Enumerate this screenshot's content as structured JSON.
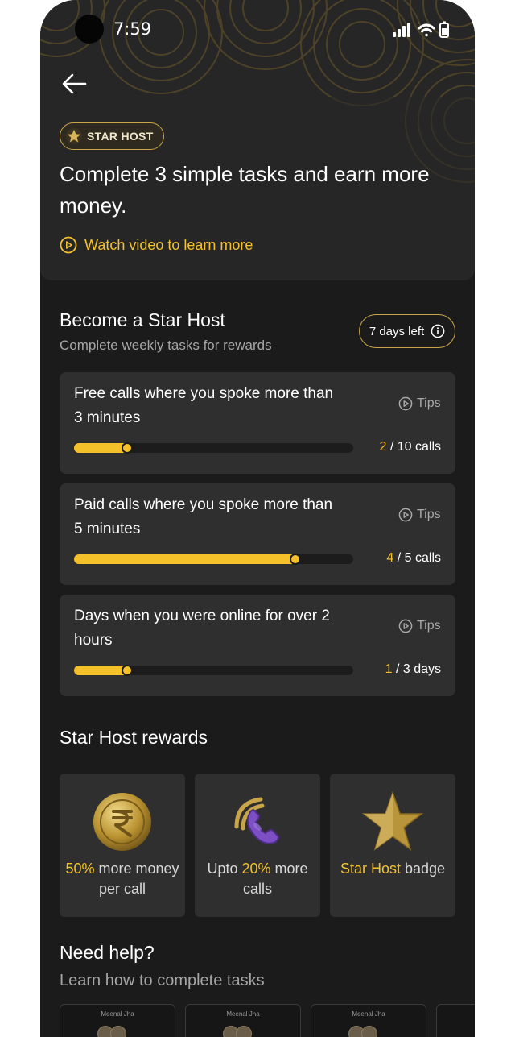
{
  "status_bar": {
    "time": "7:59"
  },
  "hero": {
    "badge": "STAR HOST",
    "title": "Complete 3 simple tasks and earn more money.",
    "watch_video": "Watch video to learn more"
  },
  "tasks_section": {
    "title": "Become a Star Host",
    "subtitle": "Complete weekly tasks for rewards",
    "days_left": "7 days left",
    "tips_label": "Tips",
    "tasks": [
      {
        "title": "Free calls where you spoke more than 3 minutes",
        "done": "2",
        "total": "/ 10 calls",
        "progress": 0.2
      },
      {
        "title": "Paid calls where you spoke more than 5 minutes",
        "done": "4",
        "total": "/ 5 calls",
        "progress": 0.8
      },
      {
        "title": "Days when you were online for over 2 hours",
        "done": "1",
        "total": "/ 3 days",
        "progress": 0.2
      }
    ]
  },
  "rewards": {
    "title": "Star Host rewards",
    "items": [
      {
        "icon": "rupee-coin-icon",
        "pre": "",
        "highlight": "50%",
        "post": " more money per call"
      },
      {
        "icon": "phone-call-icon",
        "pre": "Upto ",
        "highlight": "20%",
        "post": " more calls"
      },
      {
        "icon": "star-badge-icon",
        "pre": "",
        "highlight": "Star Host",
        "post": " badge"
      }
    ]
  },
  "help": {
    "title": "Need help?",
    "subtitle": "Learn how to complete tasks",
    "video_name": "Meenal Jha"
  },
  "colors": {
    "accent": "#f4c12b",
    "background": "#1b1b1b",
    "card": "#2f2f2f",
    "gold_border": "#c9a54a"
  }
}
